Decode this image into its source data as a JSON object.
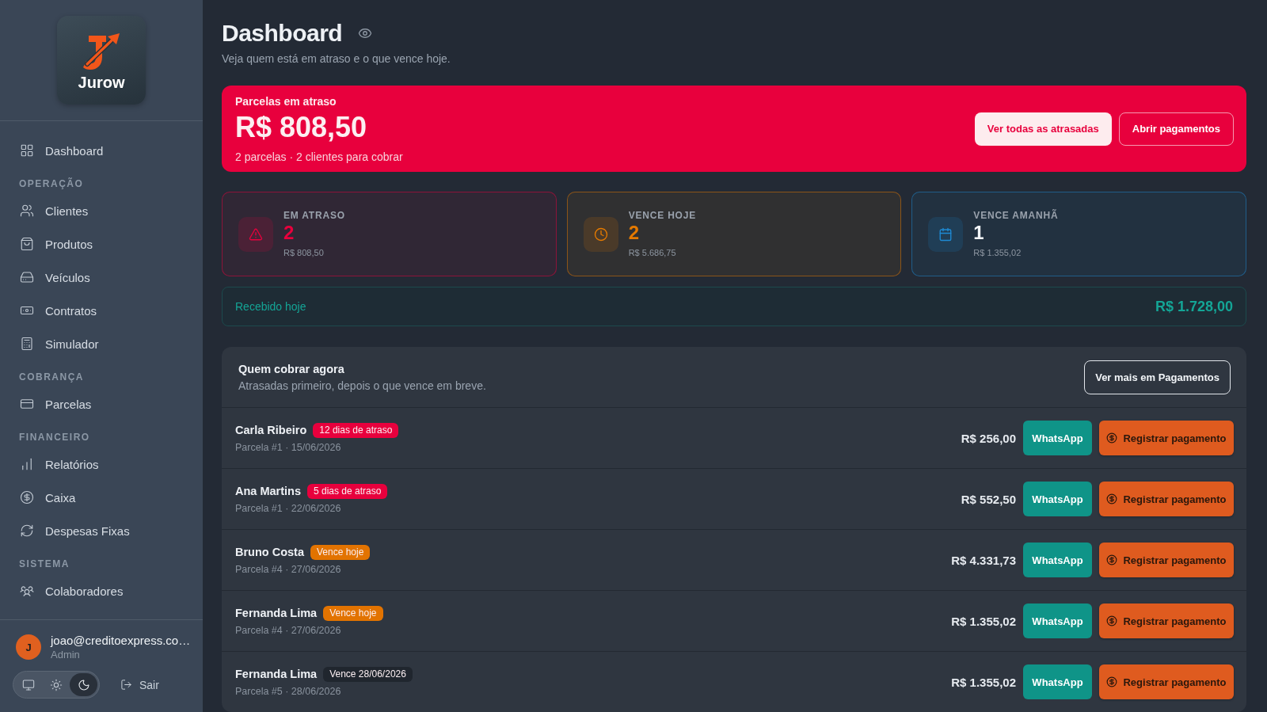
{
  "sidebar": {
    "logo": {
      "text": "Jurow"
    },
    "sections": [
      {
        "items": [
          {
            "label": "Dashboard"
          }
        ]
      },
      {
        "title": "OPERAÇÃO",
        "items": [
          {
            "label": "Clientes"
          },
          {
            "label": "Produtos"
          },
          {
            "label": "Veículos"
          },
          {
            "label": "Contratos"
          },
          {
            "label": "Simulador"
          }
        ]
      },
      {
        "title": "COBRANÇA",
        "items": [
          {
            "label": "Parcelas"
          }
        ]
      },
      {
        "title": "FINANCEIRO",
        "items": [
          {
            "label": "Relatórios"
          },
          {
            "label": "Caixa"
          },
          {
            "label": "Despesas Fixas"
          }
        ]
      },
      {
        "title": "SISTEMA",
        "items": [
          {
            "label": "Colaboradores"
          }
        ]
      }
    ],
    "user": {
      "initial": "J",
      "email": "joao@creditoexpress.co…",
      "role": "Admin"
    },
    "theme_toggle": [
      {
        "selected": false
      },
      {
        "selected": false
      },
      {
        "selected": true
      }
    ],
    "logout": "Sair"
  },
  "header": {
    "title": "Dashboard",
    "subtitle": "Veja quem está em atraso e o que vence hoje."
  },
  "overdue_banner": {
    "label": "Parcelas em atraso",
    "amount": "R$ 808,50",
    "summary": "2 parcelas · 2 clientes para cobrar",
    "buttons": [
      {
        "label": "Ver todas as atrasadas",
        "kind": "primary"
      },
      {
        "label": "Abrir pagamentos",
        "kind": "outline"
      }
    ]
  },
  "stats": [
    {
      "kind": "overdue",
      "color": "#e8003d",
      "label": "EM ATRASO",
      "value": "2",
      "amount": "R$ 808,50"
    },
    {
      "kind": "today",
      "color": "#e57a00",
      "label": "VENCE HOJE",
      "value": "2",
      "amount": "R$ 5.686,75"
    },
    {
      "kind": "upcoming",
      "color": "#1e8ad4",
      "label": "VENCE AMANHÃ",
      "value": "1",
      "amount": "R$ 1.355,02"
    }
  ],
  "received_today": {
    "label": "Recebido hoje",
    "amount": "R$ 1.728,00"
  },
  "collection": {
    "title": "Quem cobrar agora",
    "subtitle": "Atrasadas primeiro, depois o que vence em breve.",
    "button": "Ver mais em Pagamentos",
    "rows": [
      {
        "name": "Carla Ribeiro",
        "badge": {
          "text": "12 dias de atraso",
          "color": "#e8003d"
        },
        "detail": "Parcela #1 · 15/06/2026",
        "amount": "R$ 256,00",
        "whatsapp": "WhatsApp",
        "pay": "Registrar pagamento"
      },
      {
        "name": "Ana Martins",
        "badge": {
          "text": "5 dias de atraso",
          "color": "#e8003d"
        },
        "detail": "Parcela #1 · 22/06/2026",
        "amount": "R$ 552,50",
        "whatsapp": "WhatsApp",
        "pay": "Registrar pagamento"
      },
      {
        "name": "Bruno Costa",
        "badge": {
          "text": "Vence hoje",
          "color": "#e27300"
        },
        "detail": "Parcela #4 · 27/06/2026",
        "amount": "R$ 4.331,73",
        "whatsapp": "WhatsApp",
        "pay": "Registrar pagamento"
      },
      {
        "name": "Fernanda Lima",
        "badge": {
          "text": "Vence hoje",
          "color": "#e27300"
        },
        "detail": "Parcela #4 · 27/06/2026",
        "amount": "R$ 1.355,02",
        "whatsapp": "WhatsApp",
        "pay": "Registrar pagamento"
      },
      {
        "name": "Fernanda Lima",
        "badge": {
          "text": "Vence 28/06/2026",
          "color": "#20262e"
        },
        "detail": "Parcela #5 · 28/06/2026",
        "amount": "R$ 1.355,02",
        "whatsapp": "WhatsApp",
        "pay": "Registrar pagamento"
      }
    ]
  }
}
